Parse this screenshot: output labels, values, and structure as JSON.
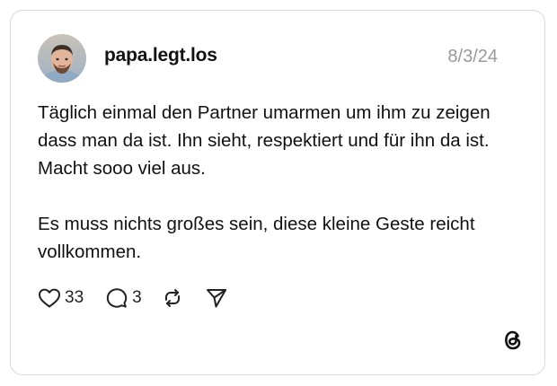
{
  "post": {
    "username": "papa.legt.los",
    "date": "8/3/24",
    "paragraphs": [
      "Täglich einmal den Partner umarmen um ihm zu zeigen dass man da ist. Ihn sieht, respektiert und für ihn da ist. Macht sooo viel aus.",
      "Es muss nichts großes sein, diese kleine Geste reicht vollkommen."
    ]
  },
  "actions": {
    "likes": "33",
    "replies": "3",
    "icons": [
      "heart-icon",
      "comment-icon",
      "repost-icon",
      "send-icon"
    ]
  },
  "branding": {
    "logo": "threads-logo"
  },
  "colors": {
    "text": "#111111",
    "muted": "#999999",
    "border": "#d9d9d9",
    "background": "#ffffff"
  }
}
